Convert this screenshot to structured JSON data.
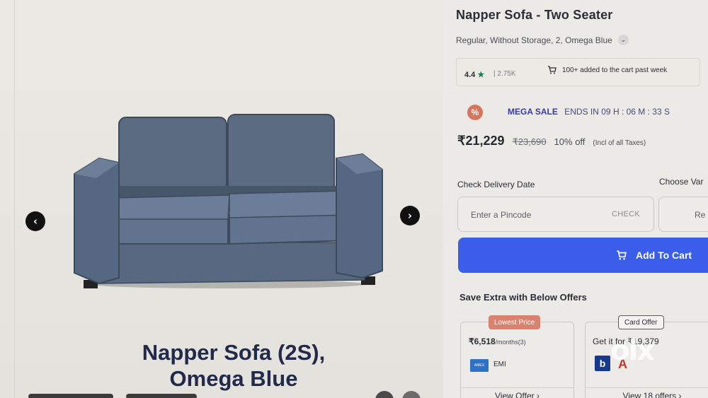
{
  "gallery": {
    "prev_icon": "chevron-left-icon",
    "next_icon": "chevron-right-icon",
    "caption_line1": "Napper Sofa (2S),",
    "caption_line2": "Omega Blue"
  },
  "product": {
    "title": "Napper Sofa - Two Seater",
    "variant": "Regular, Without Storage, 2, Omega Blue",
    "rating": "4.4",
    "rating_count": "2.75K",
    "cart_message": "100+ added to the cart past week"
  },
  "sale": {
    "label": "MEGA SALE",
    "ends_text": "ENDS IN  09 H : 06 M : 33 S"
  },
  "pricing": {
    "price": "₹21,229",
    "mrp": "₹23,690",
    "discount": "10% off",
    "tax_note": "(Incl of all Taxes)"
  },
  "delivery": {
    "label": "Check Delivery Date",
    "placeholder": "Enter a Pincode",
    "check_label": "CHECK",
    "choose_label": "Choose Var",
    "variant_button": "Re"
  },
  "cart": {
    "button_label": "Add To Cart"
  },
  "offers": {
    "title": "Save Extra with Below Offers",
    "cards": [
      {
        "badge": "Lowest Price",
        "amount": "₹6,518",
        "unit": "/months",
        "note": "(3)",
        "label": "EMI",
        "bank": "AMEX",
        "link": "View Offer ›"
      },
      {
        "badge": "Card Offer",
        "text": "Get it for ₹19,379",
        "bank1": "b",
        "bank2": "A",
        "link": "View 18 offers ›"
      }
    ]
  },
  "watermark": "olx",
  "colors": {
    "accent": "#3a5ee9",
    "sale": "#3939a6",
    "badge": "#d9826f",
    "star": "#1b7a52"
  }
}
